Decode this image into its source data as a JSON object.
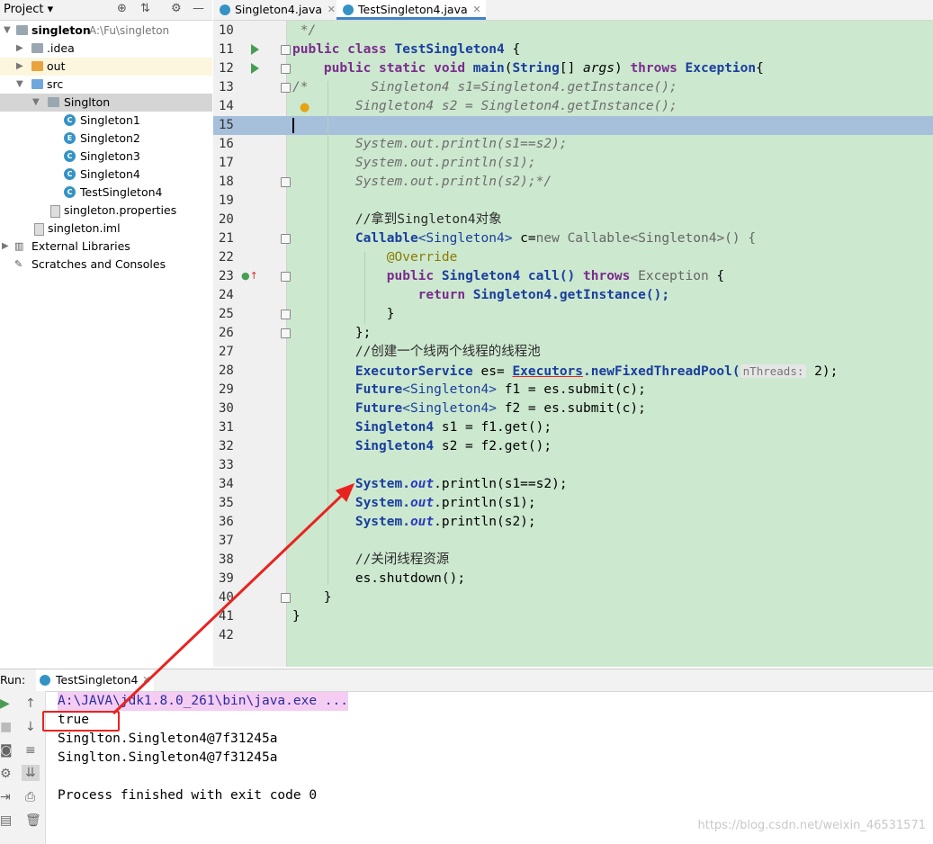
{
  "project": {
    "title": "Project",
    "items": [
      {
        "name": "singleton",
        "path": "A:\\Fu\\singleton"
      },
      {
        "name": ".idea"
      },
      {
        "name": "out"
      },
      {
        "name": "src"
      },
      {
        "name": "Singlton"
      },
      {
        "name": "Singleton1"
      },
      {
        "name": "Singleton2"
      },
      {
        "name": "Singleton3"
      },
      {
        "name": "Singleton4"
      },
      {
        "name": "TestSingleton4"
      },
      {
        "name": "singleton.properties"
      },
      {
        "name": "singleton.iml"
      },
      {
        "name": "External Libraries"
      },
      {
        "name": "Scratches and Consoles"
      }
    ]
  },
  "tabs": [
    {
      "label": "Singleton4.java"
    },
    {
      "label": "TestSingleton4.java"
    }
  ],
  "editor": {
    "line_numbers": [
      "10",
      "11",
      "12",
      "13",
      "14",
      "15",
      "16",
      "17",
      "18",
      "19",
      "20",
      "21",
      "22",
      "23",
      "24",
      "25",
      "26",
      "27",
      "28",
      "29",
      "30",
      "31",
      "32",
      "33",
      "34",
      "35",
      "36",
      "37",
      "38",
      "39",
      "40",
      "41",
      "42"
    ],
    "code": {
      "l10": " */",
      "l11_kw": "public class ",
      "l11_cls": "TestSingleton4",
      "l11_rest": " {",
      "l12_kw1": "    public static void ",
      "l12_name": "main",
      "l12_p1": "(",
      "l12_str": "String",
      "l12_p2": "[] ",
      "l12_args": "args",
      "l12_p3": ") ",
      "l12_throws": "throws ",
      "l12_exc": "Exception",
      "l12_end": "{",
      "l13_a": "/*",
      "l13_b": "        Singleton4 s1=Singleton4.getInstance();",
      "l14": "        Singleton4 s2 = Singleton4.getInstance();",
      "l16": "        System.out.println(s1==s2);",
      "l17": "        System.out.println(s1);",
      "l18": "        System.out.println(s2);*/",
      "l20": "        //拿到Singleton4对象",
      "l21_a": "        Callable",
      "l21_b": "<Singleton4>",
      "l21_c": " c=",
      "l21_d": "new ",
      "l21_e": "Callable<Singleton4>() {",
      "l22": "            @Override",
      "l23_a": "            public ",
      "l23_b": "Singleton4 ",
      "l23_c": "call() ",
      "l23_d": "throws ",
      "l23_e": "Exception",
      "l23_f": " {",
      "l24_a": "                return ",
      "l24_b": "Singleton4",
      "l24_c": ".getInstance();",
      "l25": "            }",
      "l26": "        };",
      "l27": "        //创建一个线两个线程的线程池",
      "l28_a": "        ExecutorService",
      "l28_b": " es= ",
      "l28_c": "Executors",
      "l28_d": ".newFixedThreadPool(",
      "l28_hint": "nThreads:",
      "l28_e": " 2);",
      "l29_a": "        Future",
      "l29_b": "<Singleton4>",
      "l29_c": " f1 = es.submit(c);",
      "l30_c": " f2 = es.submit(c);",
      "l31_a": "        Singleton4",
      "l31_b": " s1 = f1.get();",
      "l32_b": " s2 = f2.get();",
      "l34_a": "        System.",
      "l34_b": "out",
      "l34_c": ".println(s1==s2);",
      "l35_c": ".println(s1);",
      "l36_c": ".println(s2);",
      "l38": "        //关闭线程资源",
      "l39": "        es.shutdown();",
      "l40": "    }",
      "l41": "}"
    }
  },
  "run": {
    "label": "Run:",
    "tab": "TestSingleton4",
    "output": [
      "A:\\JAVA\\jdk1.8.0_261\\bin\\java.exe ...",
      "true",
      "Singlton.Singleton4@7f31245a",
      "Singlton.Singleton4@7f31245a",
      "",
      "Process finished with exit code 0"
    ]
  },
  "watermark": "https://blog.csdn.net/weixin_46531571",
  "colors": {
    "annotation": "#e8231f",
    "code_bg": "#cce8cf",
    "current_line": "#a6bfdb"
  }
}
